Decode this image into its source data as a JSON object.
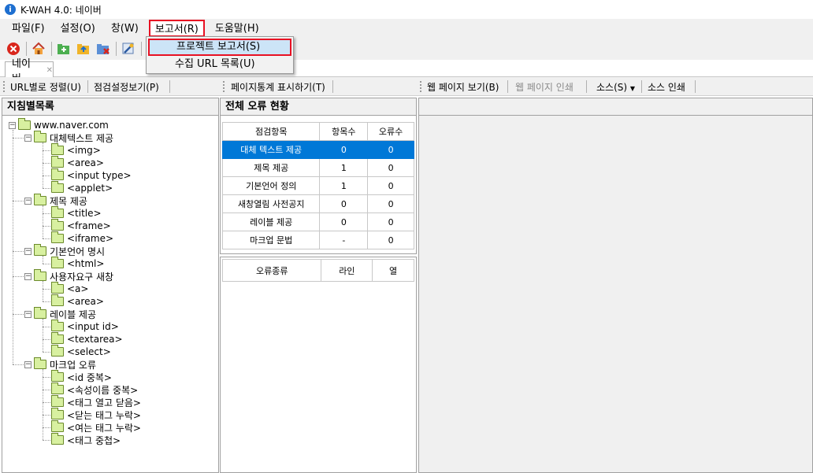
{
  "window": {
    "title": "K-WAH 4.0: 네이버"
  },
  "menu": {
    "items": [
      "파일(F)",
      "설정(O)",
      "창(W)",
      "보고서(R)",
      "도움말(H)"
    ]
  },
  "report_menu": {
    "items": [
      "프로젝트 보고서(S)",
      "수집 URL 목록(U)"
    ]
  },
  "tab": {
    "label": "네이버",
    "close": "✕"
  },
  "left_toolbar": {
    "url_sort": "URL별로 정렬(U)",
    "check_view": "점검설정보기(P)"
  },
  "mid_toolbar": {
    "page_stats": "페이지통계 표시하기(T)"
  },
  "right_toolbar": {
    "web_view": "웹 페이지 보기(B)",
    "web_print": "웹 페이지 인쇄",
    "source": "소스(S)",
    "source_print": "소스 인쇄"
  },
  "left_panel": {
    "title": "지침별목록",
    "tree": [
      {
        "label": "www.naver.com",
        "level": 0
      },
      {
        "label": "대체텍스트 제공",
        "level": 1
      },
      {
        "label": "<img>",
        "level": 2
      },
      {
        "label": "<area>",
        "level": 2
      },
      {
        "label": "<input type>",
        "level": 2
      },
      {
        "label": "<applet>",
        "level": 2
      },
      {
        "label": "제목 제공",
        "level": 1
      },
      {
        "label": "<title>",
        "level": 2
      },
      {
        "label": "<frame>",
        "level": 2
      },
      {
        "label": "<iframe>",
        "level": 2
      },
      {
        "label": "기본언어 명시",
        "level": 1
      },
      {
        "label": "<html>",
        "level": 2
      },
      {
        "label": "사용자요구 새창",
        "level": 1
      },
      {
        "label": "<a>",
        "level": 2
      },
      {
        "label": "<area>",
        "level": 2
      },
      {
        "label": "레이블 제공",
        "level": 1
      },
      {
        "label": "<input id>",
        "level": 2
      },
      {
        "label": "<textarea>",
        "level": 2
      },
      {
        "label": "<select>",
        "level": 2
      },
      {
        "label": "마크업 오류",
        "level": 1
      },
      {
        "label": "<id 중복>",
        "level": 2
      },
      {
        "label": "<속성이름 중복>",
        "level": 2
      },
      {
        "label": "<태그 열고 닫음>",
        "level": 2
      },
      {
        "label": "<닫는 태그 누락>",
        "level": 2
      },
      {
        "label": "<여는 태그 누락>",
        "level": 2
      },
      {
        "label": "<태그 중첩>",
        "level": 2
      }
    ]
  },
  "summary": {
    "title": "전체 오류 현황",
    "headers": [
      "점검항목",
      "항목수",
      "오류수"
    ],
    "rows": [
      [
        "대체 텍스트 제공",
        "0",
        "0"
      ],
      [
        "제목 제공",
        "1",
        "0"
      ],
      [
        "기본언어 정의",
        "1",
        "0"
      ],
      [
        "새창열림 사전공지",
        "0",
        "0"
      ],
      [
        "레이블 제공",
        "0",
        "0"
      ],
      [
        "마크업 문법",
        "-",
        "0"
      ]
    ]
  },
  "errors": {
    "headers": [
      "오류종류",
      "라인",
      "열"
    ]
  }
}
